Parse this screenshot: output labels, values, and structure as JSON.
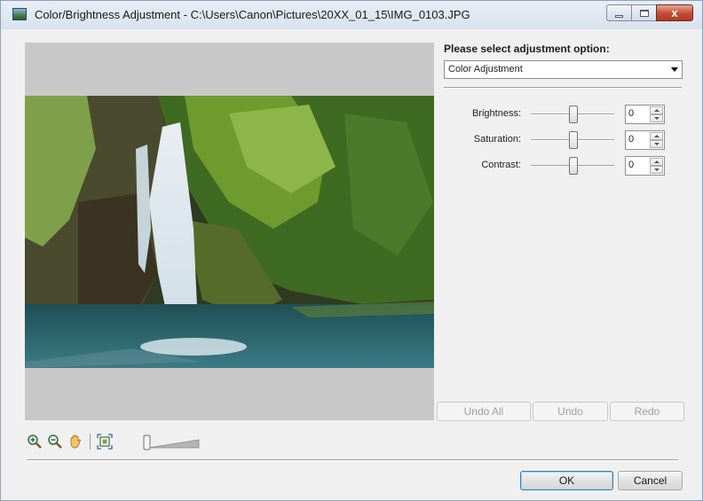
{
  "window": {
    "title": "Color/Brightness Adjustment - C:\\Users\\Canon\\Pictures\\20XX_01_15\\IMG_0103.JPG",
    "close_glyph": "x"
  },
  "options": {
    "label": "Please select adjustment option:",
    "selected": "Color Adjustment"
  },
  "adjustments": [
    {
      "label": "Brightness:",
      "value": "0"
    },
    {
      "label": "Saturation:",
      "value": "0"
    },
    {
      "label": "Contrast:",
      "value": "0"
    }
  ],
  "history_buttons": {
    "undo_all": "Undo All",
    "undo": "Undo",
    "redo": "Redo"
  },
  "dialog_buttons": {
    "ok": "OK",
    "cancel": "Cancel"
  },
  "toolbar_icons": [
    "zoom-in-icon",
    "zoom-out-icon",
    "hand-icon",
    "fit-to-window-icon"
  ],
  "zoom_level": 0
}
